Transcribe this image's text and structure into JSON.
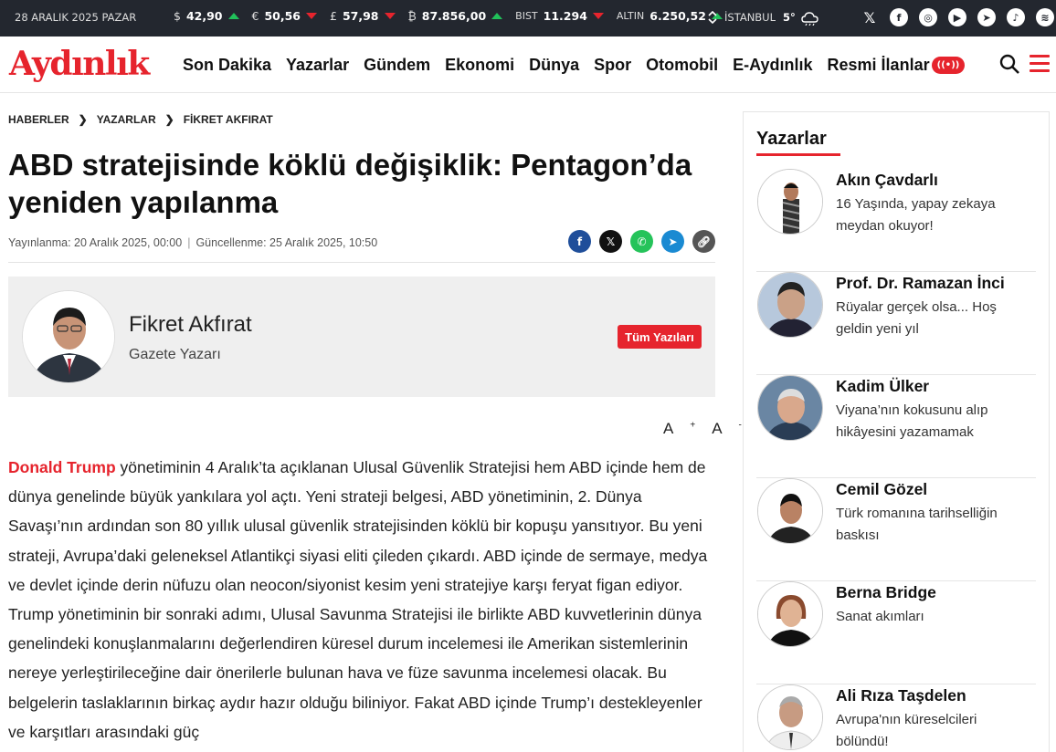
{
  "topbar": {
    "date": "28 ARALIK 2025 PAZAR",
    "rates": [
      {
        "symbol": "$",
        "value": "42,90",
        "trend": "up"
      },
      {
        "symbol": "€",
        "value": "50,56",
        "trend": "down"
      },
      {
        "symbol": "£",
        "value": "57,98",
        "trend": "down"
      },
      {
        "symbol": "₿",
        "value": "87.856,00",
        "trend": "up"
      },
      {
        "symbol": "BIST",
        "value": "11.294",
        "trend": "down"
      },
      {
        "symbol": "ALTIN",
        "value": "6.250,52",
        "trend": "up"
      }
    ],
    "city": "İSTANBUL",
    "temperature": "5°",
    "socials": [
      "x-icon",
      "facebook-icon",
      "instagram-icon",
      "youtube-icon",
      "telegram-icon",
      "tiktok-icon",
      "spotify-icon"
    ]
  },
  "header": {
    "logo": "Aydınlık",
    "nav": [
      "Son Dakika",
      "Yazarlar",
      "Gündem",
      "Ekonomi",
      "Dünya",
      "Spor",
      "Otomobil",
      "E-Aydınlık",
      "Resmi İlanlar"
    ],
    "live_label": "((•))"
  },
  "breadcrumb": [
    "HABERLER",
    "YAZARLAR",
    "FİKRET AKFIRAT"
  ],
  "article": {
    "title": "ABD stratejisinde köklü değişiklik: Pentagon’da yeniden yapılanma",
    "published": "Yayınlanma: 20 Aralık 2025, 00:00",
    "updated": "Güncellenme: 25 Aralık 2025, 10:50",
    "author_name": "Fikret Akfırat",
    "author_role": "Gazete Yazarı",
    "all_posts_label": "Tüm Yazıları",
    "font_increase": "A",
    "font_decrease": "A",
    "font_increase_sign": "+",
    "font_decrease_sign": "-",
    "body_highlight": "Donald Trump",
    "body_text": " yönetiminin 4 Aralık’ta açıklanan Ulusal Güvenlik Stratejisi hem ABD içinde hem de dünya genelinde büyük yankılara yol açtı. Yeni strateji belgesi, ABD yönetiminin, 2. Dünya Savaşı’nın ardından son 80 yıllık ulusal güvenlik stratejisinden köklü bir kopuşu yansıtıyor. Bu yeni strateji, Avrupa’daki geleneksel Atlantikçi siyasi eliti çileden çıkardı. ABD içinde de sermaye, medya ve devlet içinde derin nüfuzu olan neocon/siyonist kesim yeni stratejiye karşı feryat figan ediyor. Trump yönetiminin bir sonraki adımı, Ulusal Savunma Stratejisi ile birlikte ABD kuvvetlerinin dünya genelindeki konuşlanmalarını değerlendiren küresel durum incelemesi ile Amerikan sistemlerinin nereye yerleştirileceğine dair önerilerle bulunan hava ve füze savunma incelemesi olacak. Bu belgelerin taslaklarının birkaç aydır hazır olduğu biliniyor. Fakat ABD içinde Trump’ı destekleyenler ve karşıtları arasındaki güç"
  },
  "sidebar": {
    "title": "Yazarlar",
    "writers": [
      {
        "name": "Akın Çavdarlı",
        "headline": "16 Yaşında, yapay zekaya meydan okuyor!"
      },
      {
        "name": "Prof. Dr. Ramazan İnci",
        "headline": "Rüyalar gerçek olsa... Hoş geldin yeni yıl"
      },
      {
        "name": "Kadim Ülker",
        "headline": "Viyana’nın kokusunu alıp hikâyesini yazamamak"
      },
      {
        "name": "Cemil Gözel",
        "headline": "Türk romanına tarihselliğin baskısı"
      },
      {
        "name": "Berna Bridge",
        "headline": "Sanat akımları"
      },
      {
        "name": "Ali Rıza Taşdelen",
        "headline": "Avrupa'nın küreselcileri bölündü!"
      }
    ]
  }
}
